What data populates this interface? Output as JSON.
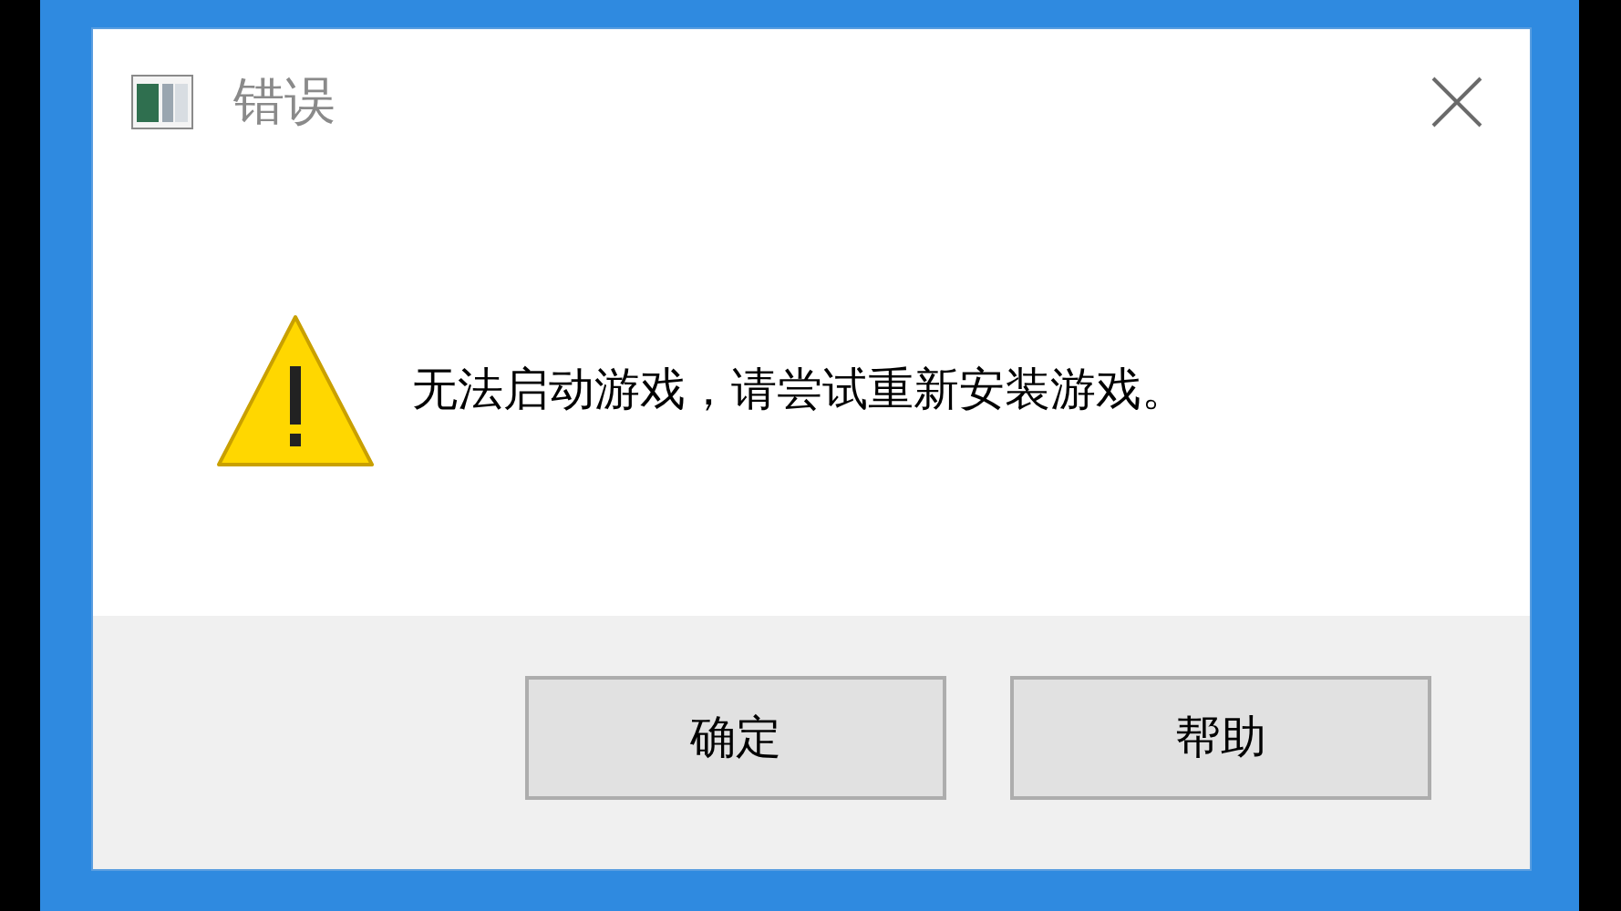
{
  "window": {
    "title": "错误"
  },
  "message": "无法启动游戏，请尝试重新安装游戏。",
  "buttons": [
    {
      "label": "确定"
    },
    {
      "label": "帮助"
    }
  ]
}
